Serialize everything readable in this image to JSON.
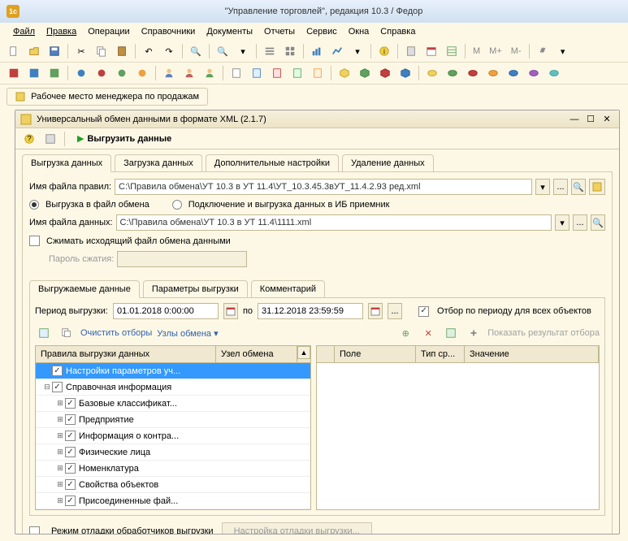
{
  "app": {
    "title": "\"Управление торговлей\", редакция 10.3 / Федор"
  },
  "menu": [
    "Файл",
    "Правка",
    "Операции",
    "Справочники",
    "Документы",
    "Отчеты",
    "Сервис",
    "Окна",
    "Справка"
  ],
  "toolbar_text": {
    "m": "M",
    "m_plus": "M+",
    "m_minus": "M-"
  },
  "workspace_tab": "Рабочее место менеджера по продажам",
  "form": {
    "title": "Универсальный обмен данными в формате XML (2.1.7)",
    "upload_btn": "Выгрузить данные",
    "tabs": [
      "Выгрузка данных",
      "Загрузка данных",
      "Дополнительные настройки",
      "Удаление данных"
    ],
    "rules_label": "Имя файла правил:",
    "rules_value": "С:\\Правила обмена\\УТ 10.3 в УТ 11.4\\УТ_10.3.45.3вУТ_11.4.2.93 ред.xml",
    "radio_file": "Выгрузка в файл обмена",
    "radio_conn": "Подключение и выгрузка данных в ИБ приемник",
    "data_label": "Имя файла данных:",
    "data_value": "С:\\Правила обмена\\УТ 10.3 в УТ 11.4\\1111.xml",
    "compress": "Сжимать исходящий файл обмена данными",
    "password_label": "Пароль сжатия:",
    "inner_tabs": [
      "Выгружаемые данные",
      "Параметры выгрузки",
      "Комментарий"
    ],
    "period_label": "Период выгрузки:",
    "date_from": "01.01.2018 0:00:00",
    "date_to_label": "по",
    "date_to": "31.12.2018 23:59:59",
    "period_filter": "Отбор по периоду для всех объектов",
    "clear_filters": "Очистить отборы",
    "nodes_link": "Узлы обмена",
    "show_result": "Показать результат отбора",
    "tree_col1": "Правила выгрузки данных",
    "tree_col2": "Узел обмена",
    "tree": [
      {
        "level": 0,
        "exp": "",
        "chk": true,
        "label": "Настройки параметров уч...",
        "sel": true
      },
      {
        "level": 0,
        "exp": "-",
        "chk": true,
        "label": "Справочная информация"
      },
      {
        "level": 1,
        "exp": "+",
        "chk": true,
        "label": "Базовые классификат..."
      },
      {
        "level": 1,
        "exp": "+",
        "chk": true,
        "label": "Предприятие"
      },
      {
        "level": 1,
        "exp": "+",
        "chk": true,
        "label": "Информация о контра..."
      },
      {
        "level": 1,
        "exp": "+",
        "chk": true,
        "label": "Физические лица"
      },
      {
        "level": 1,
        "exp": "+",
        "chk": true,
        "label": "Номенклатура"
      },
      {
        "level": 1,
        "exp": "+",
        "chk": true,
        "label": "Свойства объектов"
      },
      {
        "level": 1,
        "exp": "+",
        "chk": true,
        "label": "Присоединенные фай..."
      }
    ],
    "right_cols": [
      "",
      "Поле",
      "Тип ср...",
      "Значение"
    ],
    "debug_mode": "Режим отладки обработчиков выгрузки",
    "debug_settings": "Настройка отладки выгрузки..."
  }
}
